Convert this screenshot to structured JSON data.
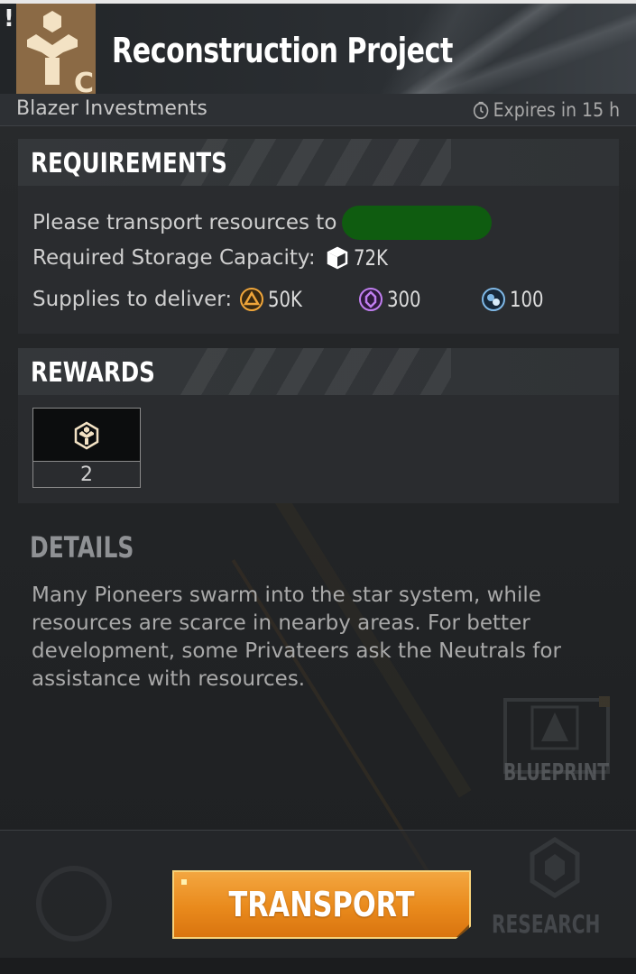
{
  "header": {
    "alert": "!",
    "title": "Reconstruction Project",
    "company": "Blazer Investments",
    "expires": "Expires in 15 h"
  },
  "requirements": {
    "title": "REQUIREMENTS",
    "line1": "Please transport resources to",
    "line2_label": "Required Storage Capacity:",
    "storage_value": "72K",
    "line3_label": "Supplies to deliver:",
    "supplies": [
      {
        "icon": "metal-icon",
        "value": "50K",
        "color": "#f0a63a"
      },
      {
        "icon": "crystal-icon",
        "value": "300",
        "color": "#c07ef0"
      },
      {
        "icon": "deuterium-icon",
        "value": "100",
        "color": "#7fb8e6"
      }
    ]
  },
  "rewards": {
    "title": "REWARDS",
    "items": [
      {
        "icon": "faction-token-icon",
        "count": "2"
      }
    ]
  },
  "details": {
    "title": "DETAILS",
    "text": "Many Pioneers swarm into the star system, while resources are scarce in nearby areas. For better development, some Privateers ask the Neutrals for assistance with resources."
  },
  "side": {
    "blueprint": "BLUEPRINT",
    "research": "RESEARCH"
  },
  "footer": {
    "transport": "TRANSPORT"
  },
  "colors": {
    "accent": "#e98a1c",
    "faction": "#8b6a45",
    "redacted": "#0f5c10"
  }
}
